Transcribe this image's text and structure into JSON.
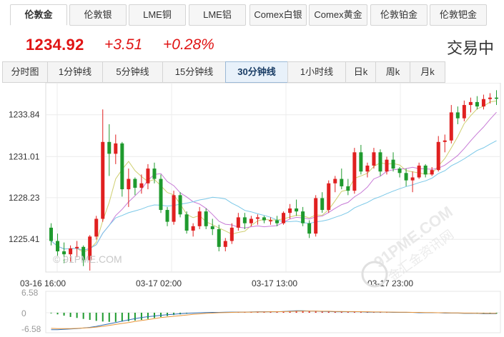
{
  "instrument_tabs": [
    {
      "label": "伦敦金",
      "active": true
    },
    {
      "label": "伦敦银",
      "active": false
    },
    {
      "label": "LME铜",
      "active": false
    },
    {
      "label": "LME铝",
      "active": false
    },
    {
      "label": "Comex白银",
      "active": false
    },
    {
      "label": "Comex黄金",
      "active": false
    },
    {
      "label": "伦敦铂金",
      "active": false
    },
    {
      "label": "伦敦钯金",
      "active": false
    }
  ],
  "quote": {
    "price": "1234.92",
    "change": "+3.51",
    "change_pct": "+0.28%",
    "status": "交易中"
  },
  "period_tabs": [
    {
      "label": "分时图",
      "active": false
    },
    {
      "label": "1分钟线",
      "active": false
    },
    {
      "label": "5分钟线",
      "active": false
    },
    {
      "label": "15分钟线",
      "active": false
    },
    {
      "label": "30分钟线",
      "active": true
    },
    {
      "label": "1小时线",
      "active": false
    },
    {
      "label": "日k",
      "active": false
    },
    {
      "label": "周k",
      "active": false
    },
    {
      "label": "月k",
      "active": false
    }
  ],
  "watermarks": {
    "left": "© 91PME.COM",
    "right_top": "91PME.COM",
    "right_bottom": "金汇金资讯网"
  },
  "colors": {
    "up": "#e02020",
    "down": "#1f9a2e",
    "ma_short": "#cfcf70",
    "ma_mid": "#c77ad6",
    "ma_long": "#7ac8e8",
    "price": "#e01414"
  },
  "chart_data": {
    "type": "candlestick",
    "y_ticks": [
      1233.84,
      1231.01,
      1228.23,
      1225.41
    ],
    "x_ticks": [
      "03-16 16:00",
      "03-17 02:00",
      "03-17 13:00",
      "03-17 23:00"
    ],
    "ylim": [
      1223.2,
      1236.0
    ],
    "candles": [
      [
        1226.2,
        1226.5,
        1225.0,
        1225.3
      ],
      [
        1225.3,
        1225.8,
        1224.3,
        1224.6
      ],
      [
        1224.6,
        1225.2,
        1223.8,
        1224.4
      ],
      [
        1224.4,
        1225.0,
        1223.9,
        1224.8
      ],
      [
        1224.8,
        1225.3,
        1224.2,
        1224.9
      ],
      [
        1224.9,
        1225.0,
        1223.6,
        1224.0
      ],
      [
        1224.0,
        1225.7,
        1223.3,
        1225.6
      ],
      [
        1225.6,
        1227.0,
        1225.4,
        1226.8
      ],
      [
        1226.8,
        1234.2,
        1226.6,
        1232.0
      ],
      [
        1232.0,
        1233.2,
        1229.7,
        1231.2
      ],
      [
        1231.2,
        1232.5,
        1230.5,
        1231.9
      ],
      [
        1231.9,
        1232.0,
        1228.3,
        1228.8
      ],
      [
        1228.8,
        1230.2,
        1227.6,
        1229.5
      ],
      [
        1229.5,
        1229.6,
        1228.4,
        1228.9
      ],
      [
        1228.9,
        1229.8,
        1228.5,
        1229.2
      ],
      [
        1229.2,
        1230.5,
        1228.8,
        1230.2
      ],
      [
        1230.2,
        1230.6,
        1229.2,
        1229.5
      ],
      [
        1229.5,
        1229.8,
        1227.2,
        1227.4
      ],
      [
        1227.4,
        1227.6,
        1226.3,
        1226.6
      ],
      [
        1226.6,
        1228.7,
        1226.4,
        1228.4
      ],
      [
        1228.4,
        1228.6,
        1226.9,
        1227.1
      ],
      [
        1227.1,
        1227.3,
        1225.8,
        1226.0
      ],
      [
        1226.0,
        1226.5,
        1225.6,
        1226.3
      ],
      [
        1226.3,
        1227.6,
        1226.1,
        1227.3
      ],
      [
        1227.3,
        1227.5,
        1226.1,
        1226.3
      ],
      [
        1226.3,
        1226.8,
        1225.7,
        1226.1
      ],
      [
        1226.1,
        1226.4,
        1224.6,
        1224.9
      ],
      [
        1224.9,
        1225.5,
        1224.6,
        1225.3
      ],
      [
        1225.3,
        1226.5,
        1225.1,
        1226.2
      ],
      [
        1226.2,
        1227.2,
        1226.0,
        1226.9
      ],
      [
        1226.9,
        1227.2,
        1226.1,
        1226.5
      ],
      [
        1226.5,
        1227.0,
        1226.3,
        1226.8
      ],
      [
        1226.8,
        1227.1,
        1226.4,
        1226.9
      ],
      [
        1226.9,
        1227.0,
        1226.5,
        1226.7
      ],
      [
        1226.7,
        1226.9,
        1226.4,
        1226.7
      ],
      [
        1226.7,
        1227.0,
        1226.3,
        1226.5
      ],
      [
        1226.5,
        1227.3,
        1226.4,
        1227.2
      ],
      [
        1227.2,
        1227.8,
        1226.8,
        1227.5
      ],
      [
        1227.5,
        1228.1,
        1227.0,
        1227.3
      ],
      [
        1227.3,
        1227.6,
        1226.3,
        1226.5
      ],
      [
        1226.5,
        1226.7,
        1225.5,
        1225.8
      ],
      [
        1225.8,
        1228.4,
        1225.6,
        1228.2
      ],
      [
        1228.2,
        1228.6,
        1227.2,
        1227.4
      ],
      [
        1227.4,
        1229.4,
        1227.2,
        1229.2
      ],
      [
        1229.2,
        1229.7,
        1228.6,
        1229.5
      ],
      [
        1229.5,
        1230.2,
        1228.8,
        1229.0
      ],
      [
        1229.0,
        1229.5,
        1228.4,
        1228.7
      ],
      [
        1228.7,
        1231.6,
        1228.5,
        1231.3
      ],
      [
        1231.3,
        1231.8,
        1229.8,
        1230.0
      ],
      [
        1230.0,
        1230.6,
        1229.6,
        1230.4
      ],
      [
        1230.4,
        1231.6,
        1230.2,
        1231.3
      ],
      [
        1231.3,
        1231.5,
        1229.7,
        1230.0
      ],
      [
        1230.0,
        1231.0,
        1229.8,
        1230.8
      ],
      [
        1230.8,
        1231.3,
        1230.0,
        1230.2
      ],
      [
        1230.2,
        1230.3,
        1229.6,
        1229.9
      ],
      [
        1229.9,
        1230.2,
        1229.0,
        1229.4
      ],
      [
        1229.4,
        1230.0,
        1228.6,
        1229.6
      ],
      [
        1229.6,
        1230.6,
        1229.5,
        1230.4
      ],
      [
        1230.4,
        1230.5,
        1229.6,
        1229.8
      ],
      [
        1229.8,
        1230.3,
        1229.7,
        1230.1
      ],
      [
        1230.1,
        1232.4,
        1230.0,
        1232.0
      ],
      [
        1232.0,
        1232.5,
        1231.3,
        1232.1
      ],
      [
        1232.1,
        1234.5,
        1231.9,
        1234.0
      ],
      [
        1234.0,
        1234.4,
        1233.2,
        1233.6
      ],
      [
        1233.6,
        1234.8,
        1233.4,
        1234.5
      ],
      [
        1234.5,
        1235.0,
        1234.0,
        1234.7
      ],
      [
        1234.7,
        1235.1,
        1234.2,
        1234.4
      ],
      [
        1234.4,
        1235.2,
        1234.2,
        1234.9
      ],
      [
        1234.9,
        1235.3,
        1234.6,
        1235.0
      ],
      [
        1235.0,
        1235.5,
        1234.5,
        1234.92
      ]
    ],
    "macd_ticks": [
      "6.58",
      "0",
      "-6.58"
    ],
    "macd_hist": [
      -0.2,
      -0.5,
      -0.9,
      -1.3,
      -1.6,
      -1.9,
      -2.2,
      -2.5,
      -2.7,
      -2.8,
      -2.8,
      -2.7,
      -2.6,
      -2.4,
      -2.2,
      -1.9,
      -1.6,
      -1.3,
      -1.0,
      -0.7,
      -0.5,
      -0.3,
      -0.15,
      -0.05,
      0.05,
      0.1,
      0.1,
      0.05,
      0.05,
      0.1,
      0.15,
      0.2,
      0.2,
      0.2,
      0.25,
      0.3,
      0.3,
      0.3,
      0.35,
      0.4,
      0.4,
      0.35,
      0.3,
      0.3,
      0.3,
      0.25,
      0.2,
      0.2,
      0.2,
      0.15,
      0.15,
      0.1,
      0.1,
      0.05,
      0.05,
      0.05,
      0.0,
      0.0,
      -0.05,
      -0.05,
      -0.1,
      -0.1,
      -0.15,
      -0.15,
      -0.2,
      -0.2,
      -0.25,
      -0.25,
      -0.3,
      -0.3
    ],
    "macd_dif": [
      -5.2,
      -5.2,
      -5.1,
      -5.0,
      -4.9,
      -4.7,
      -4.5,
      -4.2,
      -3.8,
      -3.4,
      -3.0,
      -2.6,
      -2.2,
      -1.8,
      -1.5,
      -1.2,
      -1.0,
      -0.8,
      -0.6,
      -0.45,
      -0.3,
      -0.2,
      -0.1,
      0,
      0.05,
      0.1,
      0.1,
      0.15,
      0.2,
      0.2,
      0.2,
      0.25,
      0.3,
      0.3,
      0.3,
      0.3,
      0.4,
      0.5,
      0.6,
      0.6,
      0.5,
      0.5,
      0.4,
      0.4,
      0.3,
      0.3,
      0.3,
      0.3,
      0.3,
      0.2,
      0.2,
      0.2,
      0.2,
      0.1,
      0.1,
      0.1,
      0.1,
      0,
      0,
      0,
      0,
      -0.1,
      -0.1,
      -0.1,
      -0.2,
      -0.2,
      -0.2,
      -0.3,
      -0.3,
      -0.3
    ],
    "macd_dea": [
      -4.8,
      -4.9,
      -4.9,
      -4.9,
      -4.8,
      -4.7,
      -4.6,
      -4.4,
      -4.2,
      -3.9,
      -3.6,
      -3.3,
      -3.0,
      -2.7,
      -2.4,
      -2.1,
      -1.8,
      -1.5,
      -1.3,
      -1.1,
      -0.9,
      -0.7,
      -0.5,
      -0.35,
      -0.2,
      -0.1,
      0,
      0.05,
      0.1,
      0.15,
      0.2,
      0.2,
      0.25,
      0.25,
      0.3,
      0.3,
      0.35,
      0.4,
      0.45,
      0.5,
      0.5,
      0.5,
      0.45,
      0.45,
      0.4,
      0.4,
      0.35,
      0.35,
      0.3,
      0.3,
      0.25,
      0.25,
      0.2,
      0.2,
      0.15,
      0.15,
      0.1,
      0.1,
      0.05,
      0.05,
      0,
      0,
      -0.05,
      -0.05,
      -0.1,
      -0.1,
      -0.15,
      -0.15,
      -0.2,
      -0.2
    ]
  }
}
